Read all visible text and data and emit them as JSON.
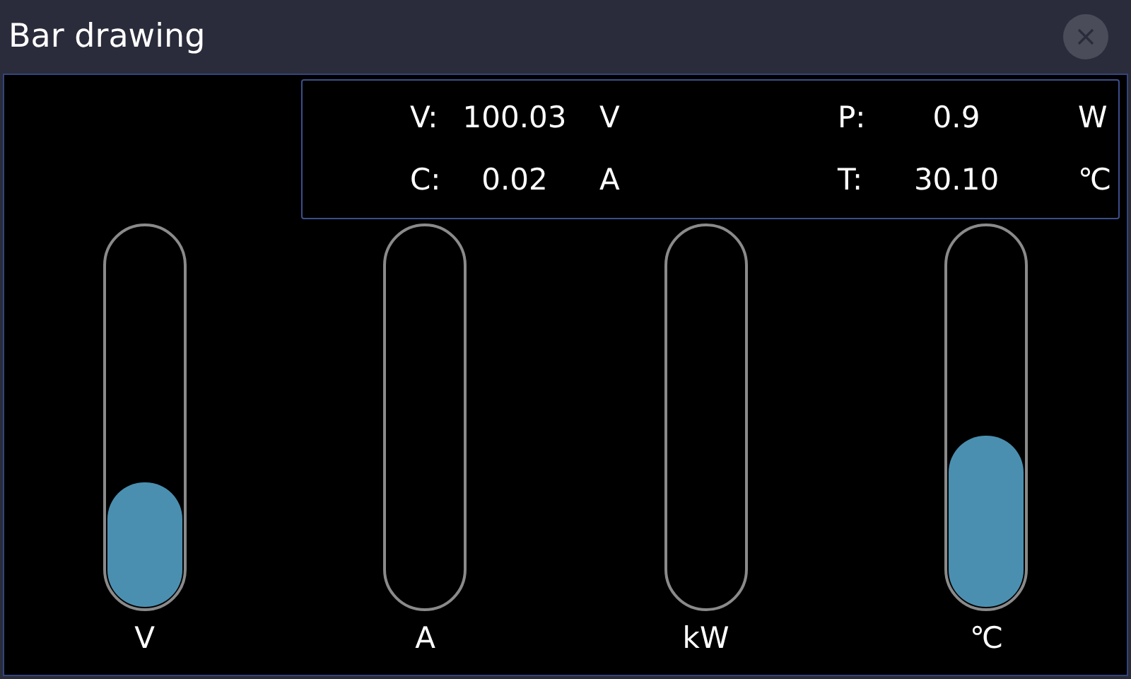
{
  "window": {
    "title": "Bar drawing"
  },
  "readings": [
    {
      "label": "V:",
      "value": "100.03",
      "unit": "V"
    },
    {
      "label": "P:",
      "value": "0.9",
      "unit": "W"
    },
    {
      "label": "C:",
      "value": "0.02",
      "unit": "A"
    },
    {
      "label": "T:",
      "value": "30.10",
      "unit": "℃"
    }
  ],
  "bars": [
    {
      "label": "V",
      "level": 0.33
    },
    {
      "label": "A",
      "level": 0
    },
    {
      "label": "kW",
      "level": 0
    },
    {
      "label": "℃",
      "level": 0.45
    }
  ]
}
